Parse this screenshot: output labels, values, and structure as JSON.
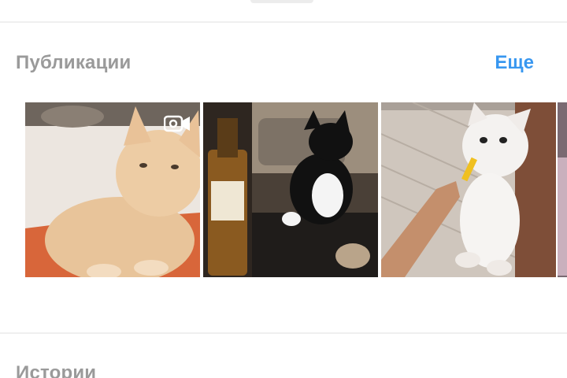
{
  "posts_section": {
    "title": "Публикации",
    "more_label": "Еще"
  },
  "stories_section": {
    "title": "Истории"
  },
  "thumbnails": [
    {
      "subject": "ginger-cat-on-orange-blanket",
      "type": "video",
      "icon": "video-camera-icon"
    },
    {
      "subject": "black-white-cat-with-whiskey-bottle",
      "type": "photo"
    },
    {
      "subject": "white-cat-eating-treat",
      "type": "photo"
    },
    {
      "subject": "partial-next-post",
      "type": "photo"
    }
  ],
  "colors": {
    "title_gray": "#9a9a9a",
    "link_blue": "#3897f0",
    "divider": "#efefef"
  }
}
